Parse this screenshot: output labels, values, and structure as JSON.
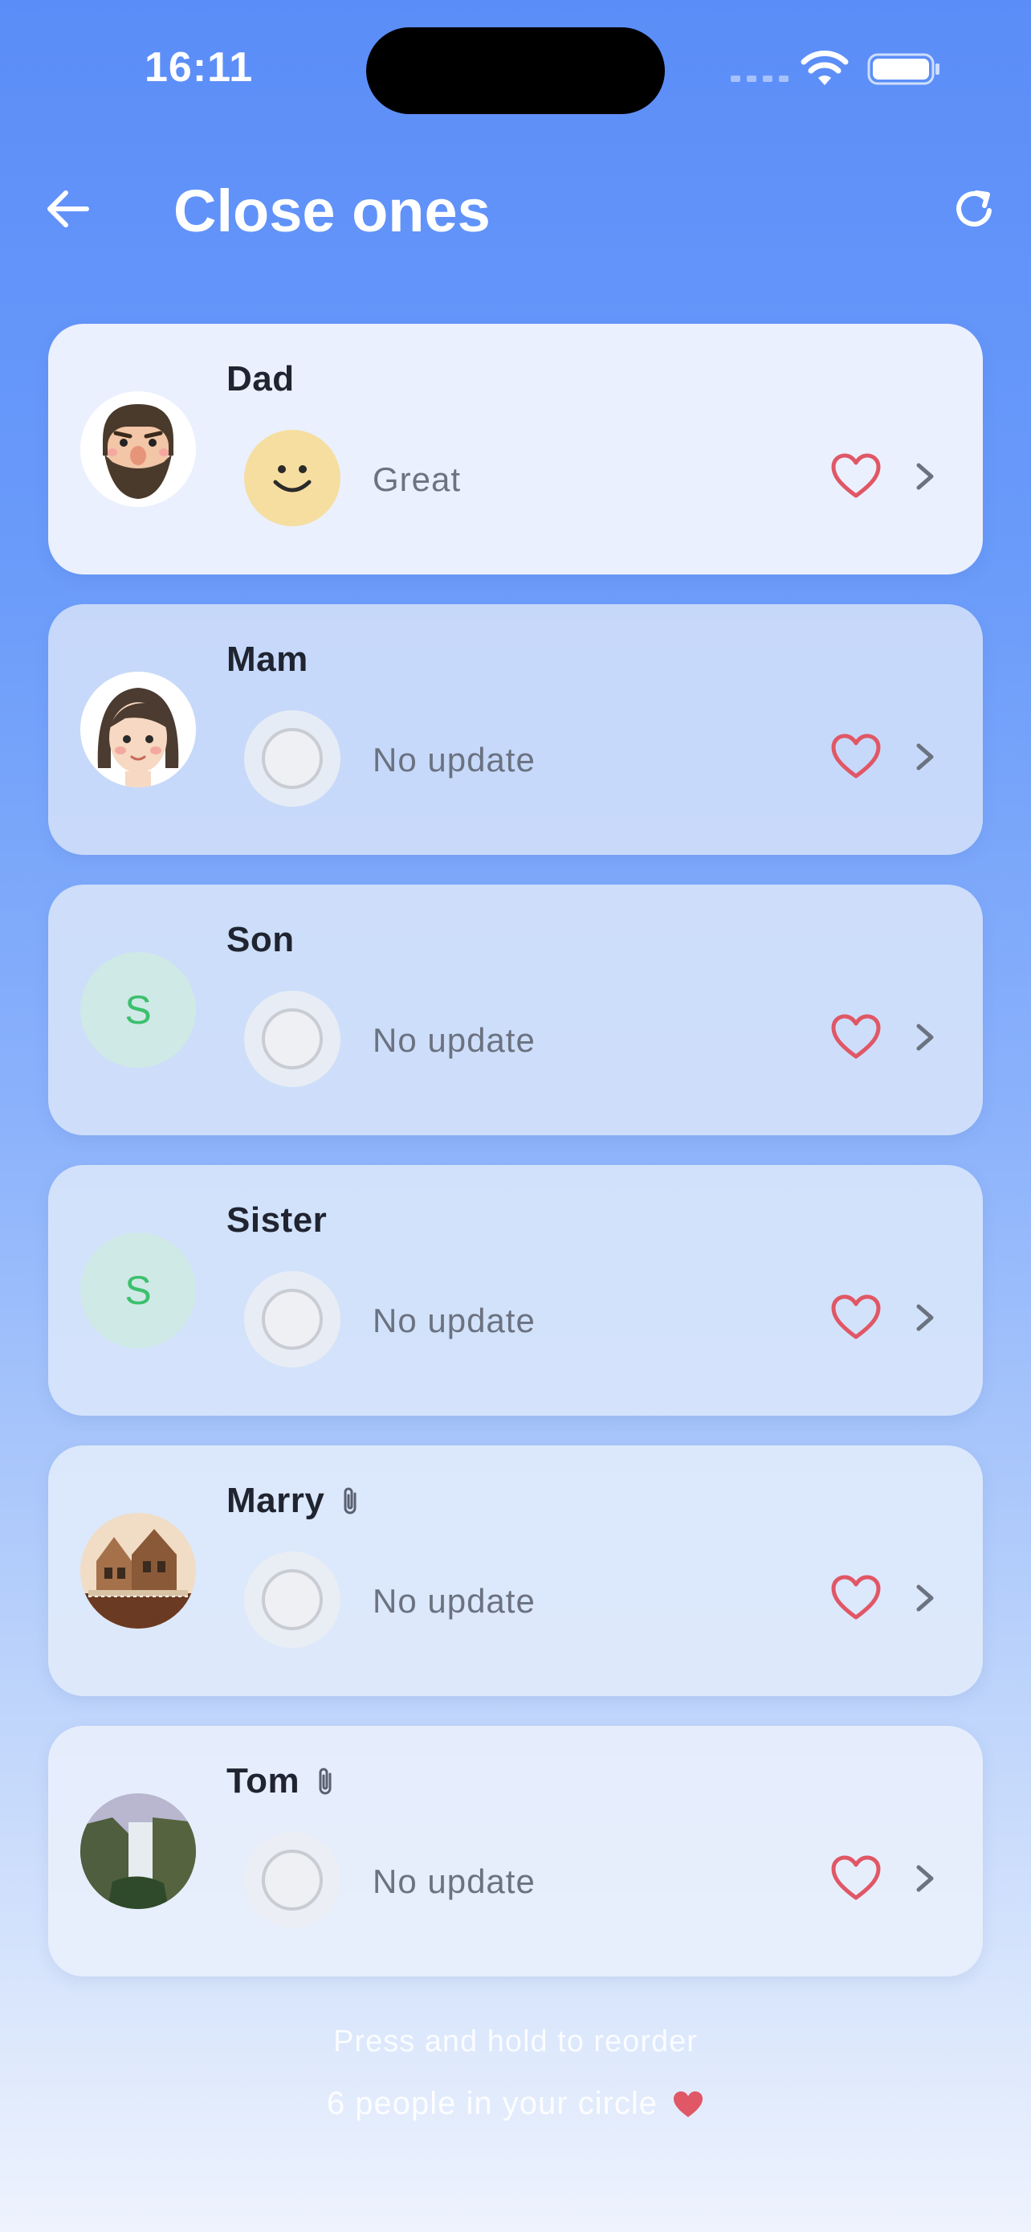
{
  "status_bar": {
    "time": "16:11"
  },
  "header": {
    "title": "Close ones"
  },
  "contacts": [
    {
      "name": "Dad",
      "status": "Great",
      "avatar": "dad-cartoon",
      "attachment": false
    },
    {
      "name": "Mam",
      "status": "No update",
      "avatar": "mom-cartoon",
      "attachment": false
    },
    {
      "name": "Son",
      "status": "No update",
      "avatar_letter": "S",
      "attachment": false
    },
    {
      "name": "Sister",
      "status": "No update",
      "avatar_letter": "S",
      "attachment": false
    },
    {
      "name": "Marry",
      "status": "No update",
      "avatar": "house-photo",
      "attachment": true
    },
    {
      "name": "Tom",
      "status": "No update",
      "avatar": "waterfall-photo",
      "attachment": true
    }
  ],
  "footer": {
    "hint": "Press and hold to reorder",
    "count_text": "6 people in your circle"
  },
  "colors": {
    "accent": "#5b8df8",
    "heart": "#e05766",
    "avatar_letter": "#3cc06e"
  }
}
